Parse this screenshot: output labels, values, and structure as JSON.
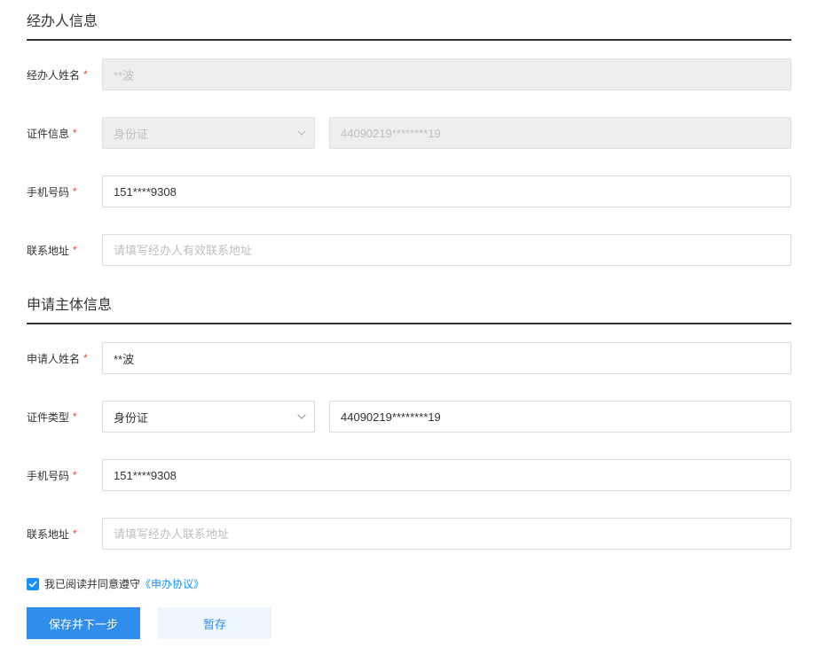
{
  "handler": {
    "title": "经办人信息",
    "name_label": "经办人姓名",
    "name_value": "**波",
    "id_info_label": "证件信息",
    "id_type_value": "身份证",
    "id_number_value": "44090219********19",
    "phone_label": "手机号码",
    "phone_value": "151****9308",
    "address_label": "联系地址",
    "address_placeholder": "请填写经办人有效联系地址"
  },
  "applicant": {
    "title": "申请主体信息",
    "name_label": "申请人姓名",
    "name_value": "**波",
    "id_type_label": "证件类型",
    "id_type_value": "身份证",
    "id_number_value": "44090219********19",
    "phone_label": "手机号码",
    "phone_value": "151****9308",
    "address_label": "联系地址",
    "address_placeholder": "请填写经办人联系地址"
  },
  "agreement": {
    "text": "我已阅读并同意遵守",
    "link": "《申办协议》"
  },
  "buttons": {
    "save_next": "保存并下一步",
    "draft": "暂存"
  }
}
